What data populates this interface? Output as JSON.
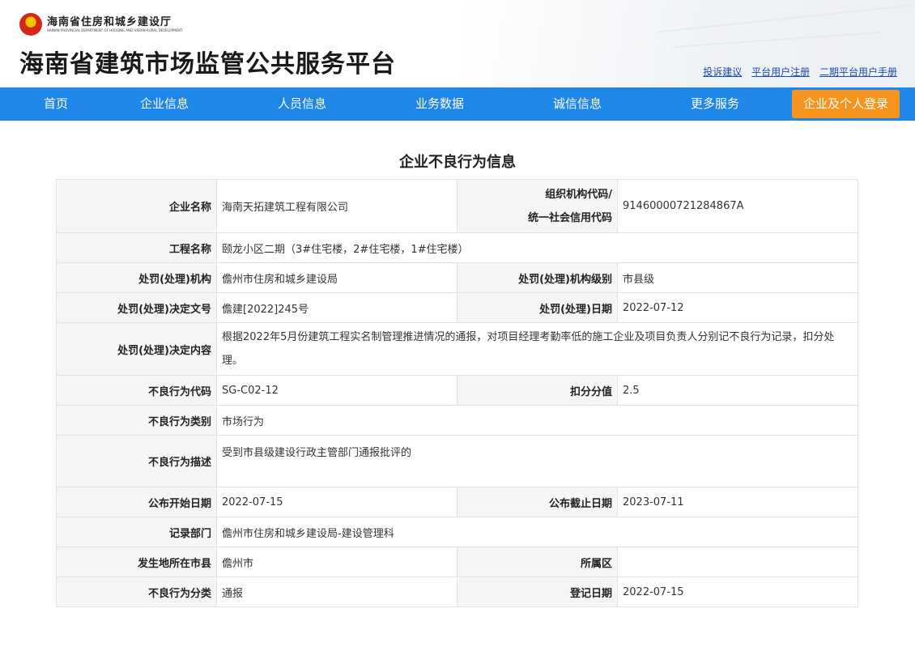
{
  "header": {
    "dept_name": "海南省住房和城乡建设厅",
    "dept_name_en": "HAINAN PROVINCIAL DEPARTMENT OF HOUSING AND URBAN-RURAL DEVELOPMENT",
    "site_title": "海南省建筑市场监管公共服务平台",
    "links": [
      "投诉建议",
      "平台用户注册",
      "二期平台用户手册"
    ]
  },
  "nav": {
    "items": [
      "首页",
      "企业信息",
      "人员信息",
      "业务数据",
      "诚信信息",
      "更多服务"
    ],
    "login": "企业及个人登录"
  },
  "page_title": "企业不良行为信息",
  "record": {
    "company_name_label": "企业名称",
    "company_name": "海南天拓建筑工程有限公司",
    "org_code_label_1": "组织机构代码/",
    "org_code_label_2": "统一社会信用代码",
    "org_code": "91460000721284867A",
    "project_label": "工程名称",
    "project": "颐龙小区二期（3#住宅楼，2#住宅楼，1#住宅楼）",
    "authority_label": "处罚(处理)机构",
    "authority": "儋州市住房和城乡建设局",
    "authority_level_label": "处罚(处理)机构级别",
    "authority_level": "市县级",
    "decision_no_label": "处罚(处理)决定文号",
    "decision_no": "儋建[2022]245号",
    "decision_date_label": "处罚(处理)日期",
    "decision_date": "2022-07-12",
    "decision_content_label": "处罚(处理)决定内容",
    "decision_content": "根据2022年5月份建筑工程实名制管理推进情况的通报，对项目经理考勤率低的施工企业及项目负责人分别记不良行为记录，扣分处理。",
    "behavior_code_label": "不良行为代码",
    "behavior_code": "SG-C02-12",
    "deduct_label": "扣分分值",
    "deduct": "2.5",
    "category_label": "不良行为类别",
    "category": "市场行为",
    "description_label": "不良行为描述",
    "description": "受到市县级建设行政主管部门通报批评的",
    "publish_start_label": "公布开始日期",
    "publish_start": "2022-07-15",
    "publish_end_label": "公布截止日期",
    "publish_end": "2023-07-11",
    "record_dept_label": "记录部门",
    "record_dept": "儋州市住房和城乡建设局-建设管理科",
    "city_label": "发生地所在市县",
    "city": "儋州市",
    "district_label": "所属区",
    "district": "",
    "classification_label": "不良行为分类",
    "classification": "通报",
    "register_date_label": "登记日期",
    "register_date": "2022-07-15"
  }
}
